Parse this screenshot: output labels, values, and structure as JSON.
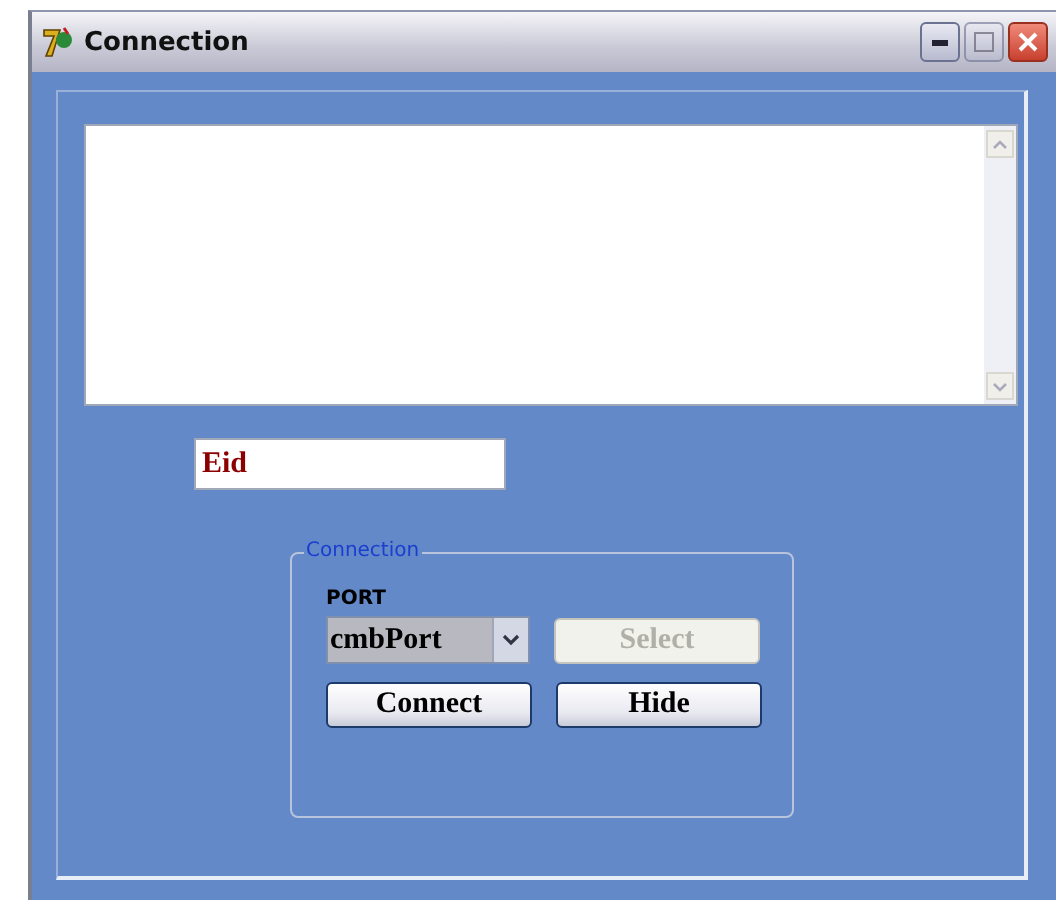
{
  "window": {
    "title": "Connection"
  },
  "eid_field": {
    "value": "Eid"
  },
  "group": {
    "title": "Connection",
    "port_label": "PORT",
    "port_combo": {
      "value": "cmbPort",
      "text_selected": true
    },
    "buttons": [
      {
        "label": "Select",
        "disabled": true
      },
      {
        "label": "Connect",
        "disabled": false
      },
      {
        "label": "Hide",
        "disabled": false
      }
    ]
  }
}
